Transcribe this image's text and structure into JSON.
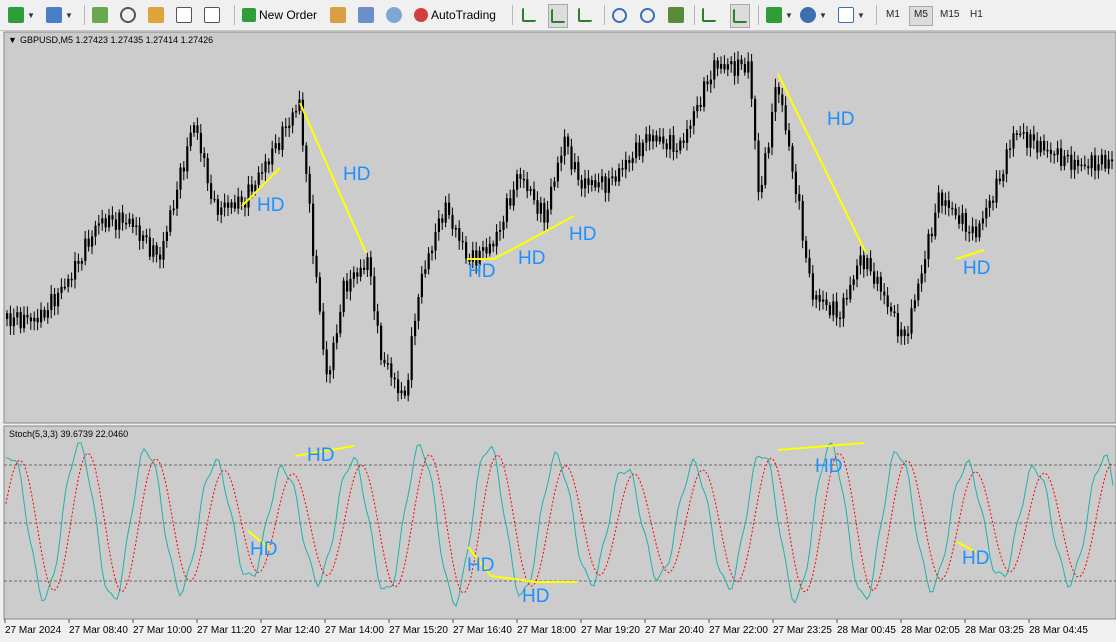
{
  "toolbar": {
    "new_order_label": "New Order",
    "autotrading_label": "AutoTrading",
    "timeframes": [
      "M1",
      "M5",
      "M15",
      "H1"
    ],
    "active_timeframe": "M5"
  },
  "main_chart": {
    "header": "GBPUSD,M5  1.27423 1.27435 1.27414 1.27426"
  },
  "indicator": {
    "header": "Stoch(5,3,3) 39.6739 22.0460"
  },
  "annotations": {
    "main": [
      "HD",
      "HD",
      "HD",
      "HD",
      "HD",
      "HD",
      "HD"
    ],
    "stoch": [
      "HD",
      "HD",
      "HD",
      "HD",
      "HD",
      "HD"
    ]
  },
  "time_axis": [
    "27 Mar 2024",
    "27 Mar 08:40",
    "27 Mar 10:00",
    "27 Mar 11:20",
    "27 Mar 12:40",
    "27 Mar 14:00",
    "27 Mar 15:20",
    "27 Mar 16:40",
    "27 Mar 18:00",
    "27 Mar 19:20",
    "27 Mar 20:40",
    "27 Mar 22:00",
    "27 Mar 23:25",
    "28 Mar 00:45",
    "28 Mar 02:05",
    "28 Mar 03:25",
    "28 Mar 04:45"
  ],
  "colors": {
    "chart_bg": "#cccccc",
    "candles": "#000000",
    "divergence": "#ffff00",
    "label": "#1e90ff",
    "stoch_main": "#20b2aa",
    "stoch_signal": "#ff0000"
  }
}
